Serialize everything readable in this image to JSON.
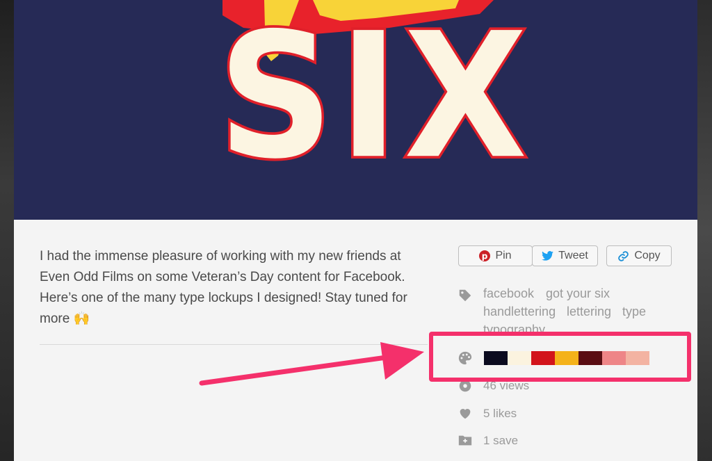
{
  "artwork": {
    "word": "SIX",
    "colors": {
      "background": "#262a56",
      "letter_fill": "#fcf5e2",
      "letter_outline": "#e0202a",
      "brush_red": "#e8222b",
      "brush_yellow": "#f8d338"
    }
  },
  "description": "I had the immense pleasure of working with my new friends at Even Odd Films on some Veteran’s Day content for Facebook. Here’s one of the many type lockups I designed! Stay tuned for more 🙌",
  "share": {
    "pin_label": "Pin",
    "tweet_label": "Tweet",
    "copy_label": "Copy"
  },
  "tags": [
    "facebook",
    "got your six",
    "handlettering",
    "lettering",
    "type",
    "typography"
  ],
  "palette": {
    "colors": [
      "#0b0b1f",
      "#fbf3df",
      "#d2141b",
      "#f4b21a",
      "#5a0d12",
      "#ee8587",
      "#f3b3a2"
    ]
  },
  "stats": {
    "views": "46 views",
    "likes": "5 likes",
    "saves": "1 save"
  },
  "annotation": {
    "color": "#f4306b"
  }
}
